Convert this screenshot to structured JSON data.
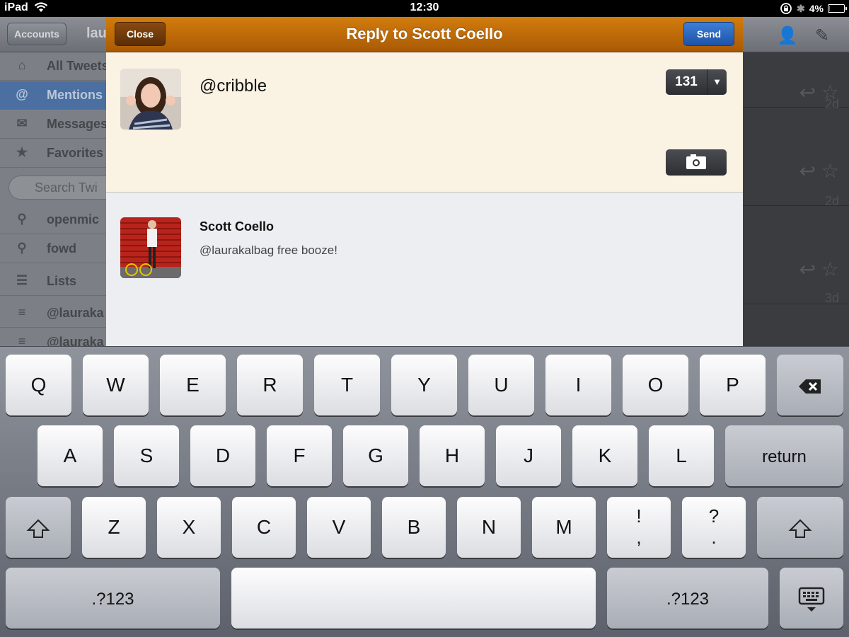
{
  "status_bar": {
    "device": "iPad",
    "time": "12:30",
    "battery": "4%",
    "battery_level": 0.04
  },
  "background": {
    "accounts_button": "Accounts",
    "title": "lau",
    "sidebar": [
      {
        "label": "All Tweets",
        "icon": "home-icon"
      },
      {
        "label": "Mentions",
        "icon": "at-icon"
      },
      {
        "label": "Messages",
        "icon": "envelope-icon"
      },
      {
        "label": "Favorites",
        "icon": "star-icon"
      }
    ],
    "search_placeholder": "Search Twi",
    "saved_searches": [
      {
        "label": "openmic"
      },
      {
        "label": "fowd"
      }
    ],
    "lists_label": "Lists",
    "lists": [
      {
        "label": "@lauraka"
      },
      {
        "label": "@lauraka"
      }
    ],
    "timeline_ages": [
      "2d",
      "2d",
      "3d"
    ]
  },
  "modal": {
    "title": "Reply to Scott Coello",
    "close_label": "Close",
    "send_label": "Send",
    "compose_text": "@cribble",
    "char_count": "131",
    "in_reply_to": {
      "author": "Scott Coello",
      "text": "@laurakalbag free booze!"
    }
  },
  "keyboard": {
    "row1": [
      "Q",
      "W",
      "E",
      "R",
      "T",
      "Y",
      "U",
      "I",
      "O",
      "P"
    ],
    "row2": [
      "A",
      "S",
      "D",
      "F",
      "G",
      "H",
      "J",
      "K",
      "L"
    ],
    "row3": [
      "Z",
      "X",
      "C",
      "V",
      "B",
      "N",
      "M"
    ],
    "return_label": "return",
    "numbers_label": ".?123",
    "punct1": [
      "!",
      ","
    ],
    "punct2": [
      "?",
      "."
    ]
  }
}
